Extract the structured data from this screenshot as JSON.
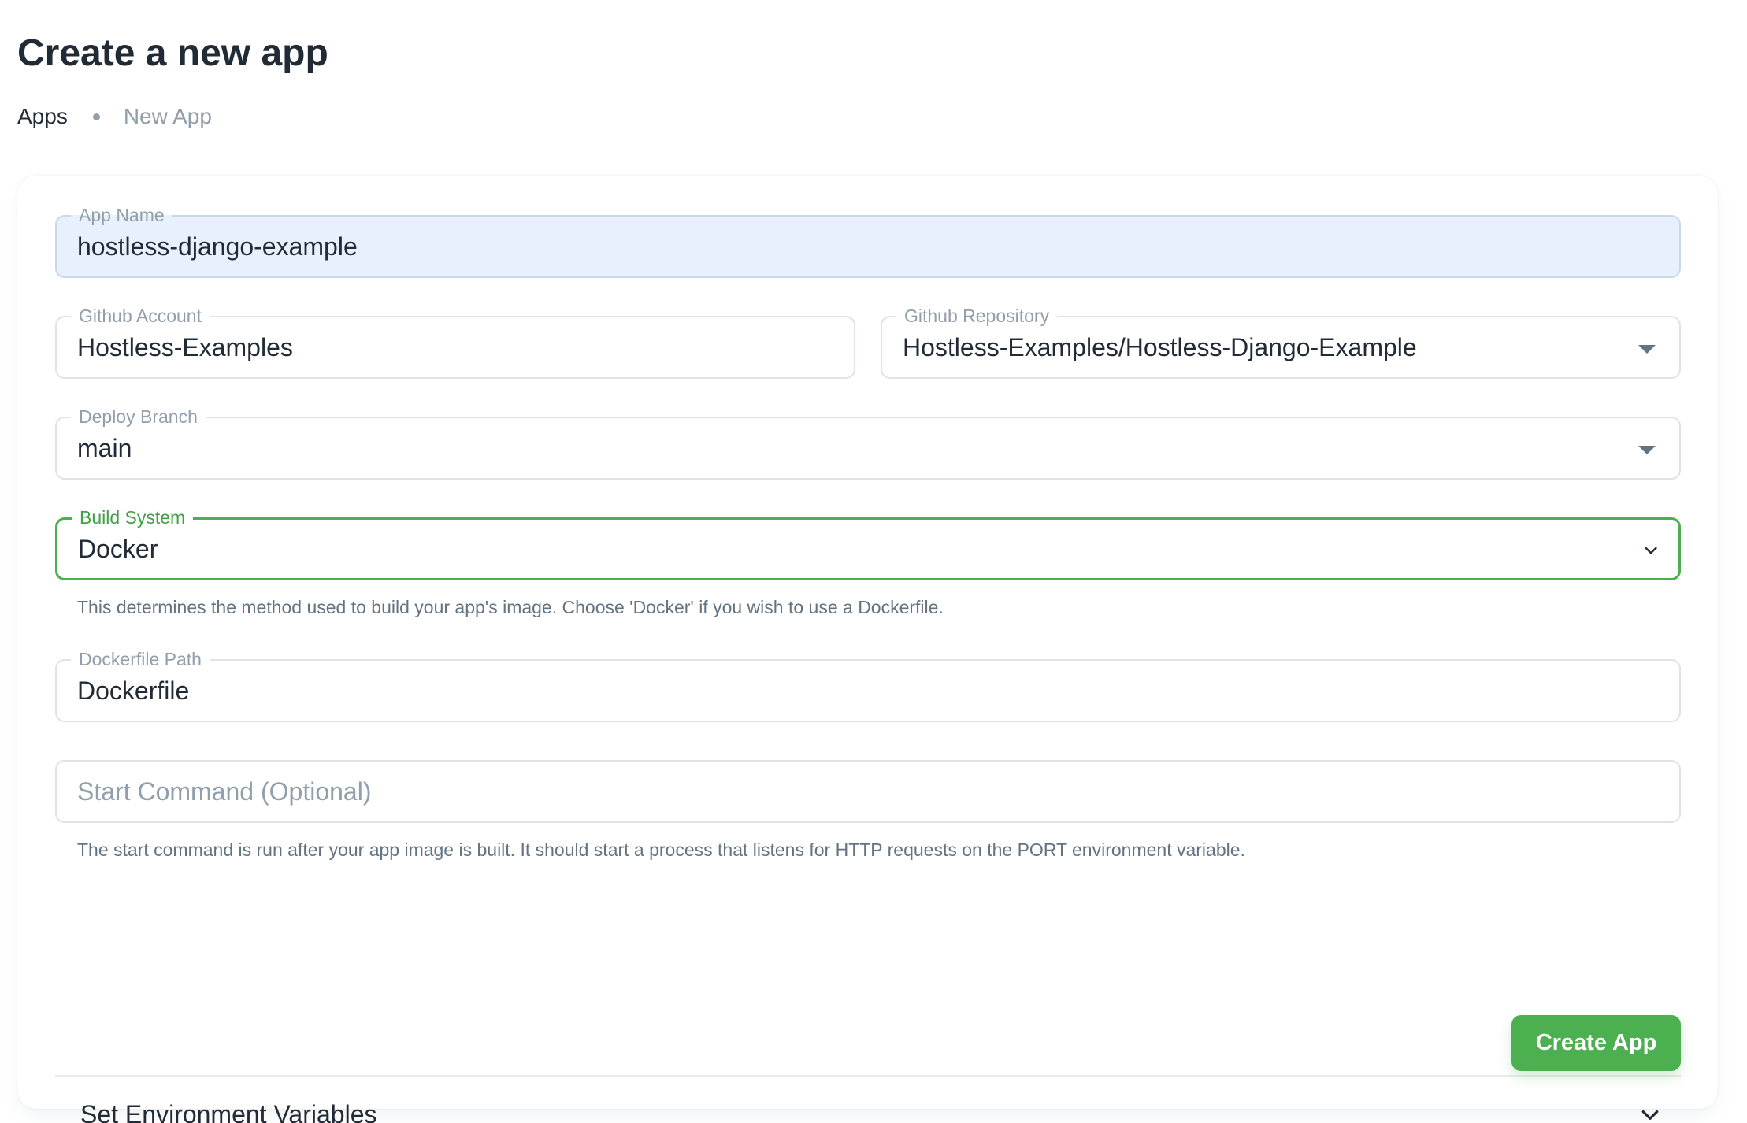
{
  "header": {
    "title": "Create a new app"
  },
  "breadcrumb": {
    "items": [
      "Apps",
      "New App"
    ]
  },
  "form": {
    "app_name": {
      "label": "App Name",
      "value": "hostless-django-example"
    },
    "github_account": {
      "label": "Github Account",
      "value": "Hostless-Examples"
    },
    "github_repository": {
      "label": "Github Repository",
      "value": "Hostless-Examples/Hostless-Django-Example"
    },
    "deploy_branch": {
      "label": "Deploy Branch",
      "value": "main"
    },
    "build_system": {
      "label": "Build System",
      "value": "Docker",
      "helper": "This determines the method used to build your app's image. Choose 'Docker' if you wish to use a Dockerfile."
    },
    "dockerfile_path": {
      "label": "Dockerfile Path",
      "value": "Dockerfile"
    },
    "start_command": {
      "placeholder": "Start Command (Optional)",
      "value": "",
      "helper": "The start command is run after your app image is built. It should start a process that listens for HTTP requests on the PORT environment variable."
    },
    "env_vars": {
      "label": "Set Environment Variables"
    },
    "submit_label": "Create App"
  },
  "colors": {
    "primary": "#4caf50",
    "text": "#212b36",
    "muted": "#919eab",
    "autofill_bg": "#e8f0fe"
  },
  "icons": {
    "repo_dropdown": "caret-down-icon",
    "branch_dropdown": "caret-down-icon",
    "build_system_dropdown": "chevron-down-icon",
    "accordion": "chevron-down-icon"
  }
}
